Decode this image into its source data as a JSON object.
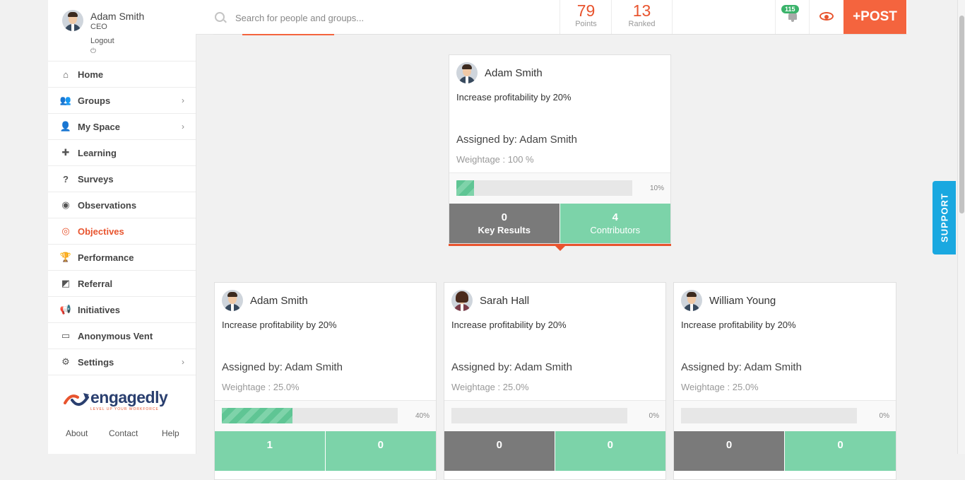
{
  "user": {
    "name": "Adam Smith",
    "role": "CEO",
    "logout": "Logout",
    "power_glyph": "⏻"
  },
  "sidebar": {
    "items": [
      {
        "label": "Home",
        "icon": "home-icon",
        "glyph": "⌂",
        "chevron": false
      },
      {
        "label": "Groups",
        "icon": "groups-icon",
        "glyph": "👥",
        "chevron": true
      },
      {
        "label": "My Space",
        "icon": "user-icon",
        "glyph": "👤",
        "chevron": true
      },
      {
        "label": "Learning",
        "icon": "puzzle-icon",
        "glyph": "✚",
        "chevron": false
      },
      {
        "label": "Surveys",
        "icon": "question-icon",
        "glyph": "?",
        "chevron": false
      },
      {
        "label": "Observations",
        "icon": "eye-icon",
        "glyph": "◉",
        "chevron": false
      },
      {
        "label": "Objectives",
        "icon": "target-icon",
        "glyph": "◎",
        "chevron": false,
        "active": true
      },
      {
        "label": "Performance",
        "icon": "trophy-icon",
        "glyph": "🏆",
        "chevron": false
      },
      {
        "label": "Referral",
        "icon": "share-icon",
        "glyph": "◩",
        "chevron": false
      },
      {
        "label": "Initiatives",
        "icon": "megaphone-icon",
        "glyph": "📢",
        "chevron": false
      },
      {
        "label": "Anonymous Vent",
        "icon": "inbox-icon",
        "glyph": "▭",
        "chevron": false
      },
      {
        "label": "Settings",
        "icon": "gear-icon",
        "glyph": "⚙",
        "chevron": true
      }
    ],
    "chevron_glyph": "›",
    "logo_text": "engagedly",
    "logo_tagline": "LEVEL UP YOUR WORKFORCE",
    "footer": [
      "About",
      "Contact",
      "Help"
    ]
  },
  "topbar": {
    "search_placeholder": "Search for people and groups...",
    "points_value": "79",
    "points_label": "Points",
    "ranked_value": "13",
    "ranked_label": "Ranked",
    "notifications": "115",
    "post_label": "+POST"
  },
  "support_label": "SUPPORT",
  "cards": [
    {
      "name": "Adam Smith",
      "objective": "Increase profitability by 20%",
      "assigned": "Assigned by: Adam Smith",
      "weightage": "Weightage : 100 %",
      "progress": 10,
      "progress_label": "10%",
      "key_results": "0",
      "key_results_label": "Key Results",
      "contributors": "4",
      "contributors_label": "Contributors",
      "avatar": "male",
      "kr_color": "gray"
    },
    {
      "name": "Adam Smith",
      "objective": "Increase profitability by 20%",
      "assigned": "Assigned by: Adam Smith",
      "weightage": "Weightage : 25.0%",
      "progress": 40,
      "progress_label": "40%",
      "key_results": "1",
      "contributors": "0",
      "avatar": "male",
      "kr_color": "green"
    },
    {
      "name": "Sarah Hall",
      "objective": "Increase profitability by 20%",
      "assigned": "Assigned by: Adam Smith",
      "weightage": "Weightage : 25.0%",
      "progress": 0,
      "progress_label": "0%",
      "key_results": "0",
      "contributors": "0",
      "avatar": "female",
      "kr_color": "gray"
    },
    {
      "name": "William Young",
      "objective": "Increase profitability by 20%",
      "assigned": "Assigned by: Adam Smith",
      "weightage": "Weightage : 25.0%",
      "progress": 0,
      "progress_label": "0%",
      "key_results": "0",
      "contributors": "0",
      "avatar": "male",
      "kr_color": "gray"
    }
  ]
}
